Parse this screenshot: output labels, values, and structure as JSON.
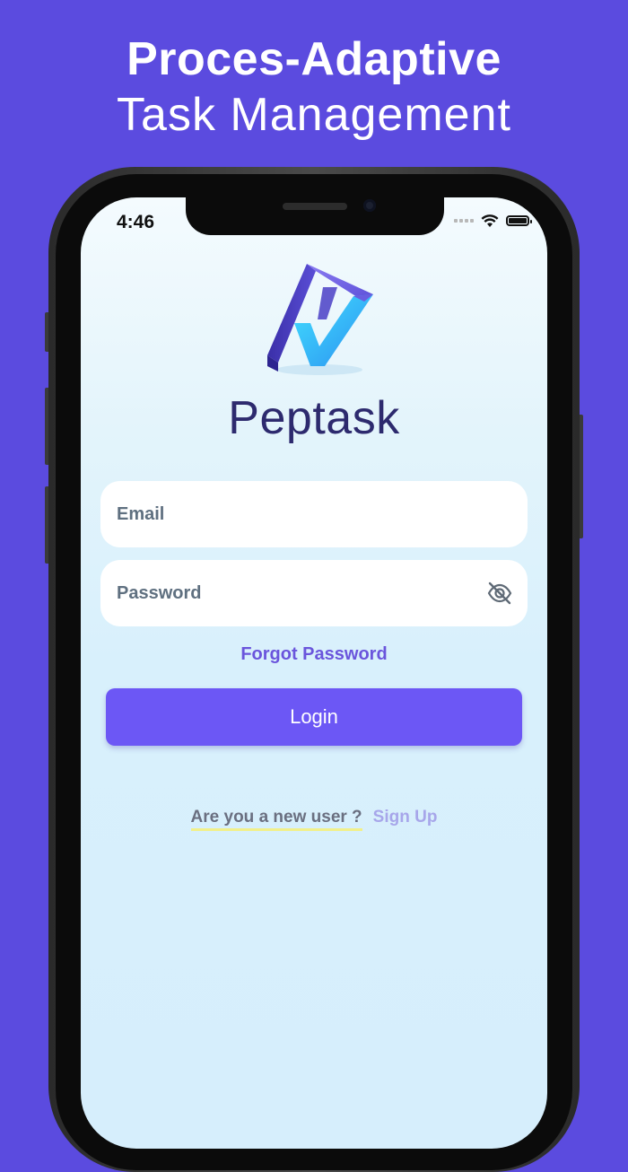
{
  "promo": {
    "headline_line1": "Proces-Adaptive",
    "headline_line2": "Task Management"
  },
  "status_bar": {
    "time": "4:46",
    "icons": [
      "signal-icon",
      "wifi-icon",
      "battery-icon"
    ]
  },
  "app": {
    "name": "Peptask",
    "logo": "peptask-logo"
  },
  "login_form": {
    "email_placeholder": "Email",
    "email_value": "",
    "password_placeholder": "Password",
    "password_value": "",
    "password_toggle_icon": "eye-off-icon",
    "forgot_password": "Forgot Password",
    "login_button": "Login",
    "new_user_text": "Are you a new user ?",
    "signup_link": "Sign Up"
  },
  "colors": {
    "background": "#5b4bdf",
    "primary_button": "#6c57f5",
    "link": "#6a55dc",
    "title": "#2d2a6e",
    "signup_link": "#a7a6ea",
    "underline": "#f1f08a"
  }
}
